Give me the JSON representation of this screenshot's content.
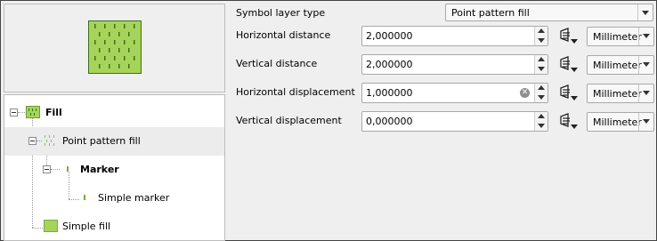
{
  "tree": {
    "nodes": [
      {
        "label": "Fill",
        "bold": true
      },
      {
        "label": "Point pattern fill",
        "bold": false
      },
      {
        "label": "Marker",
        "bold": true
      },
      {
        "label": "Simple marker",
        "bold": false
      },
      {
        "label": "Simple fill",
        "bold": false
      }
    ]
  },
  "properties": {
    "layer_type_label": "Symbol layer type",
    "layer_type_value": "Point pattern fill",
    "rows": [
      {
        "label": "Horizontal distance",
        "value": "2,000000",
        "unit": "Millimeter"
      },
      {
        "label": "Vertical distance",
        "value": "2,000000",
        "unit": "Millimeter"
      },
      {
        "label": "Horizontal displacement",
        "value": "1,000000",
        "unit": "Millimeter"
      },
      {
        "label": "Vertical displacement",
        "value": "0,000000",
        "unit": "Millimeter"
      }
    ]
  },
  "icons": {
    "data_defined": "data-defined-override-icon",
    "clear": "clear-field-icon"
  },
  "colors": {
    "fill": "#a6d45a",
    "marker": "#3e6e1e",
    "selection": "#ececec"
  }
}
